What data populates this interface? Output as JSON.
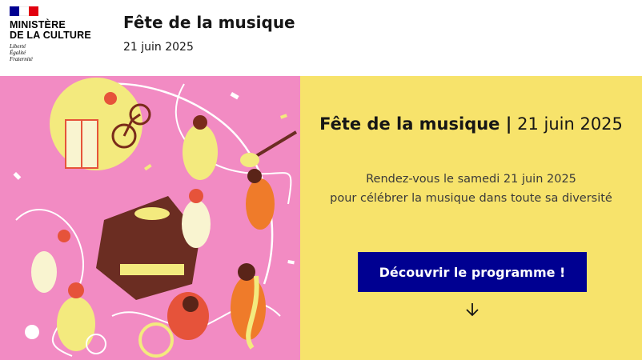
{
  "header": {
    "ministry_line1": "Ministère",
    "ministry_line2": "de la Culture",
    "motto_1": "Liberté",
    "motto_2": "Égalité",
    "motto_3": "Fraternité",
    "site_title": "Fête de la musique",
    "site_tagline": "21 juin 2025"
  },
  "hero": {
    "heading_bold": "Fête de la musique |",
    "heading_regular": " 21 juin 2025",
    "desc_line1": "Rendez-vous le samedi 21 juin 2025",
    "desc_line2": "pour célébrer la musique dans toute sa diversité",
    "cta_label": "Découvrir le programme !",
    "scroll_icon": "arrow-down-icon",
    "illustration": "music-festival-illustration"
  },
  "colors": {
    "primary_blue": "#000091",
    "flag_red": "#e1000f",
    "hero_pink": "#f28bc3",
    "hero_yellow": "#f7e36b"
  }
}
